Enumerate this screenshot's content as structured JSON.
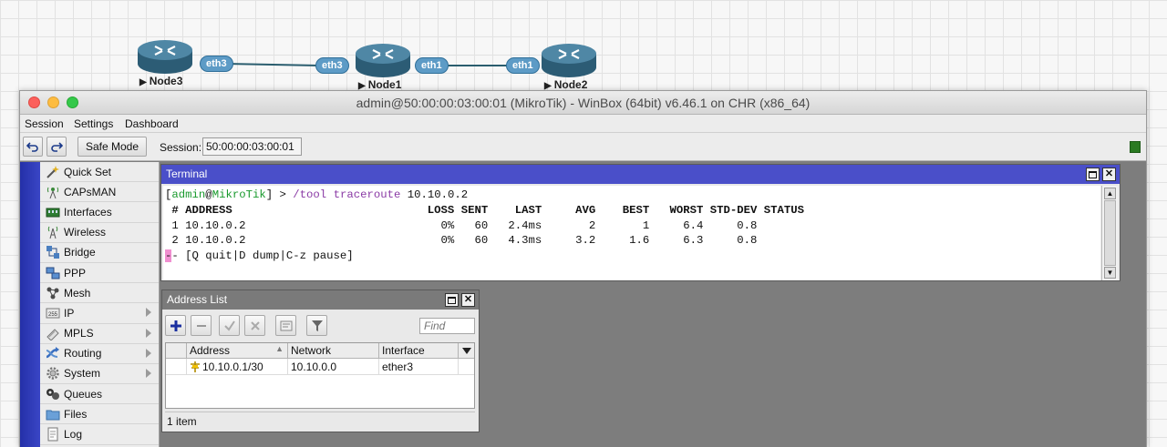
{
  "topology": {
    "nodes": [
      {
        "name": "Node3",
        "icon": "router-icon"
      },
      {
        "name": "Node1",
        "icon": "router-icon"
      },
      {
        "name": "Node2",
        "icon": "router-icon"
      }
    ],
    "ports": [
      "eth3",
      "eth3",
      "eth1",
      "eth1"
    ]
  },
  "window": {
    "title": "admin@50:00:00:03:00:01 (MikroTik) - WinBox (64bit) v6.46.1 on CHR (x86_64)"
  },
  "menu": [
    "Session",
    "Settings",
    "Dashboard"
  ],
  "toolbar": {
    "safe_mode": "Safe Mode",
    "session_label": "Session:",
    "session_value": "50:00:00:03:00:01"
  },
  "sidebar": {
    "items": [
      {
        "label": "Quick Set",
        "icon": "wand-icon",
        "submenu": false
      },
      {
        "label": "CAPsMAN",
        "icon": "antenna-icon",
        "submenu": false
      },
      {
        "label": "Interfaces",
        "icon": "ethernet-port-icon",
        "submenu": false
      },
      {
        "label": "Wireless",
        "icon": "wifi-tower-icon",
        "submenu": false
      },
      {
        "label": "Bridge",
        "icon": "bridge-icon",
        "submenu": false
      },
      {
        "label": "PPP",
        "icon": "ppp-icon",
        "submenu": false
      },
      {
        "label": "Mesh",
        "icon": "mesh-icon",
        "submenu": false
      },
      {
        "label": "IP",
        "icon": "ip-icon",
        "submenu": true
      },
      {
        "label": "MPLS",
        "icon": "mpls-icon",
        "submenu": true
      },
      {
        "label": "Routing",
        "icon": "routing-icon",
        "submenu": true
      },
      {
        "label": "System",
        "icon": "gear-icon",
        "submenu": true
      },
      {
        "label": "Queues",
        "icon": "queues-icon",
        "submenu": false
      },
      {
        "label": "Files",
        "icon": "folder-icon",
        "submenu": false
      },
      {
        "label": "Log",
        "icon": "log-icon",
        "submenu": false
      }
    ]
  },
  "terminal": {
    "title": "Terminal",
    "prompt_user": "admin",
    "prompt_host": "MikroTik",
    "command": "/tool",
    "command_sub": "traceroute",
    "command_arg": "10.10.0.2",
    "columns": [
      "#",
      "ADDRESS",
      "LOSS",
      "SENT",
      "LAST",
      "AVG",
      "BEST",
      "WORST",
      "STD-DEV",
      "STATUS"
    ],
    "rows": [
      {
        "num": "1",
        "address": "10.10.0.2",
        "loss": "0%",
        "sent": "60",
        "last": "2.4ms",
        "avg": "2",
        "best": "1",
        "worst": "6.4",
        "stddev": "0.8",
        "status": ""
      },
      {
        "num": "2",
        "address": "10.10.0.2",
        "loss": "0%",
        "sent": "60",
        "last": "4.3ms",
        "avg": "3.2",
        "best": "1.6",
        "worst": "6.3",
        "stddev": "0.8",
        "status": ""
      }
    ],
    "footer": "- [Q quit|D dump|C-z pause]"
  },
  "address_list": {
    "title": "Address List",
    "find_placeholder": "Find",
    "columns": [
      "Address",
      "Network",
      "Interface"
    ],
    "rows": [
      {
        "address": "10.10.0.1/30",
        "network": "10.10.0.0",
        "interface": "ether3"
      }
    ],
    "status": "1 item"
  },
  "colors": {
    "terminal_titlebar": "#4a4fc9",
    "sidebar_strip": "#2430a8",
    "status_led": "#2a7a22",
    "port_badge": "#5d9bc6"
  }
}
